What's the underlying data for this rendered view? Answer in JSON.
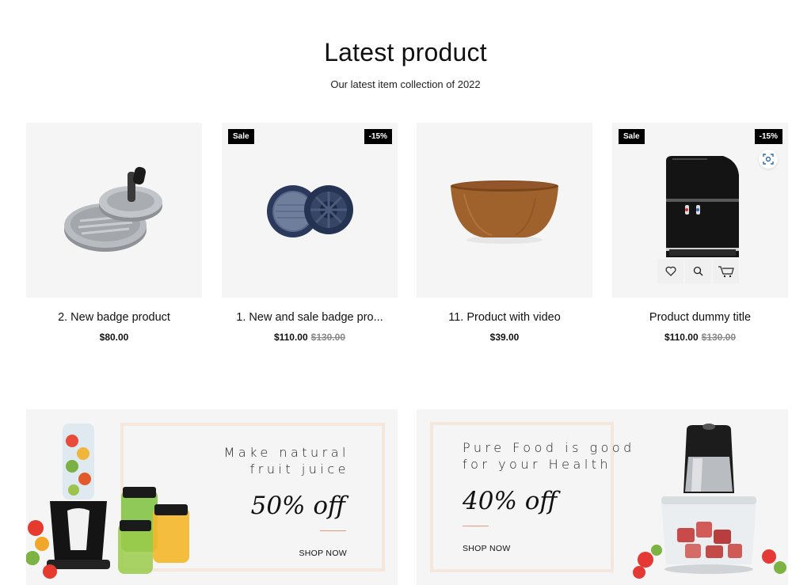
{
  "section": {
    "title": "Latest product",
    "subtitle": "Our latest item collection of 2022"
  },
  "products": [
    {
      "name": "2. New badge product",
      "price": "$80.00",
      "old_price": "",
      "badge_left": "",
      "badge_right": "",
      "image": "burger-press-icon"
    },
    {
      "name": "1. New and sale badge pro...",
      "price": "$110.00",
      "old_price": "$130.00",
      "badge_left": "Sale",
      "badge_right": "-15%",
      "image": "lids-icon"
    },
    {
      "name": "11. Product with video",
      "price": "$39.00",
      "old_price": "",
      "badge_left": "",
      "badge_right": "",
      "image": "wooden-bowl-icon"
    },
    {
      "name": "Product dummy title",
      "price": "$110.00",
      "old_price": "$130.00",
      "badge_left": "Sale",
      "badge_right": "-15%",
      "image": "water-dispenser-icon"
    }
  ],
  "product_actions": [
    "wishlist-icon",
    "quick-view-icon",
    "cart-icon"
  ],
  "banners": [
    {
      "title_line1": "Make natural",
      "title_line2": "fruit juice",
      "offer": "50% off",
      "cta": "SHOP NOW",
      "image": "blender-icon"
    },
    {
      "title_line1": "Pure Food is good",
      "title_line2": "for your Health",
      "offer": "40% off",
      "cta": "SHOP NOW",
      "image": "food-chopper-icon"
    }
  ],
  "colors": {
    "badge": "#000000",
    "card_bg": "#f5f5f5",
    "frame": "#f6e7dd",
    "accent_rule": "#e39a7c"
  }
}
